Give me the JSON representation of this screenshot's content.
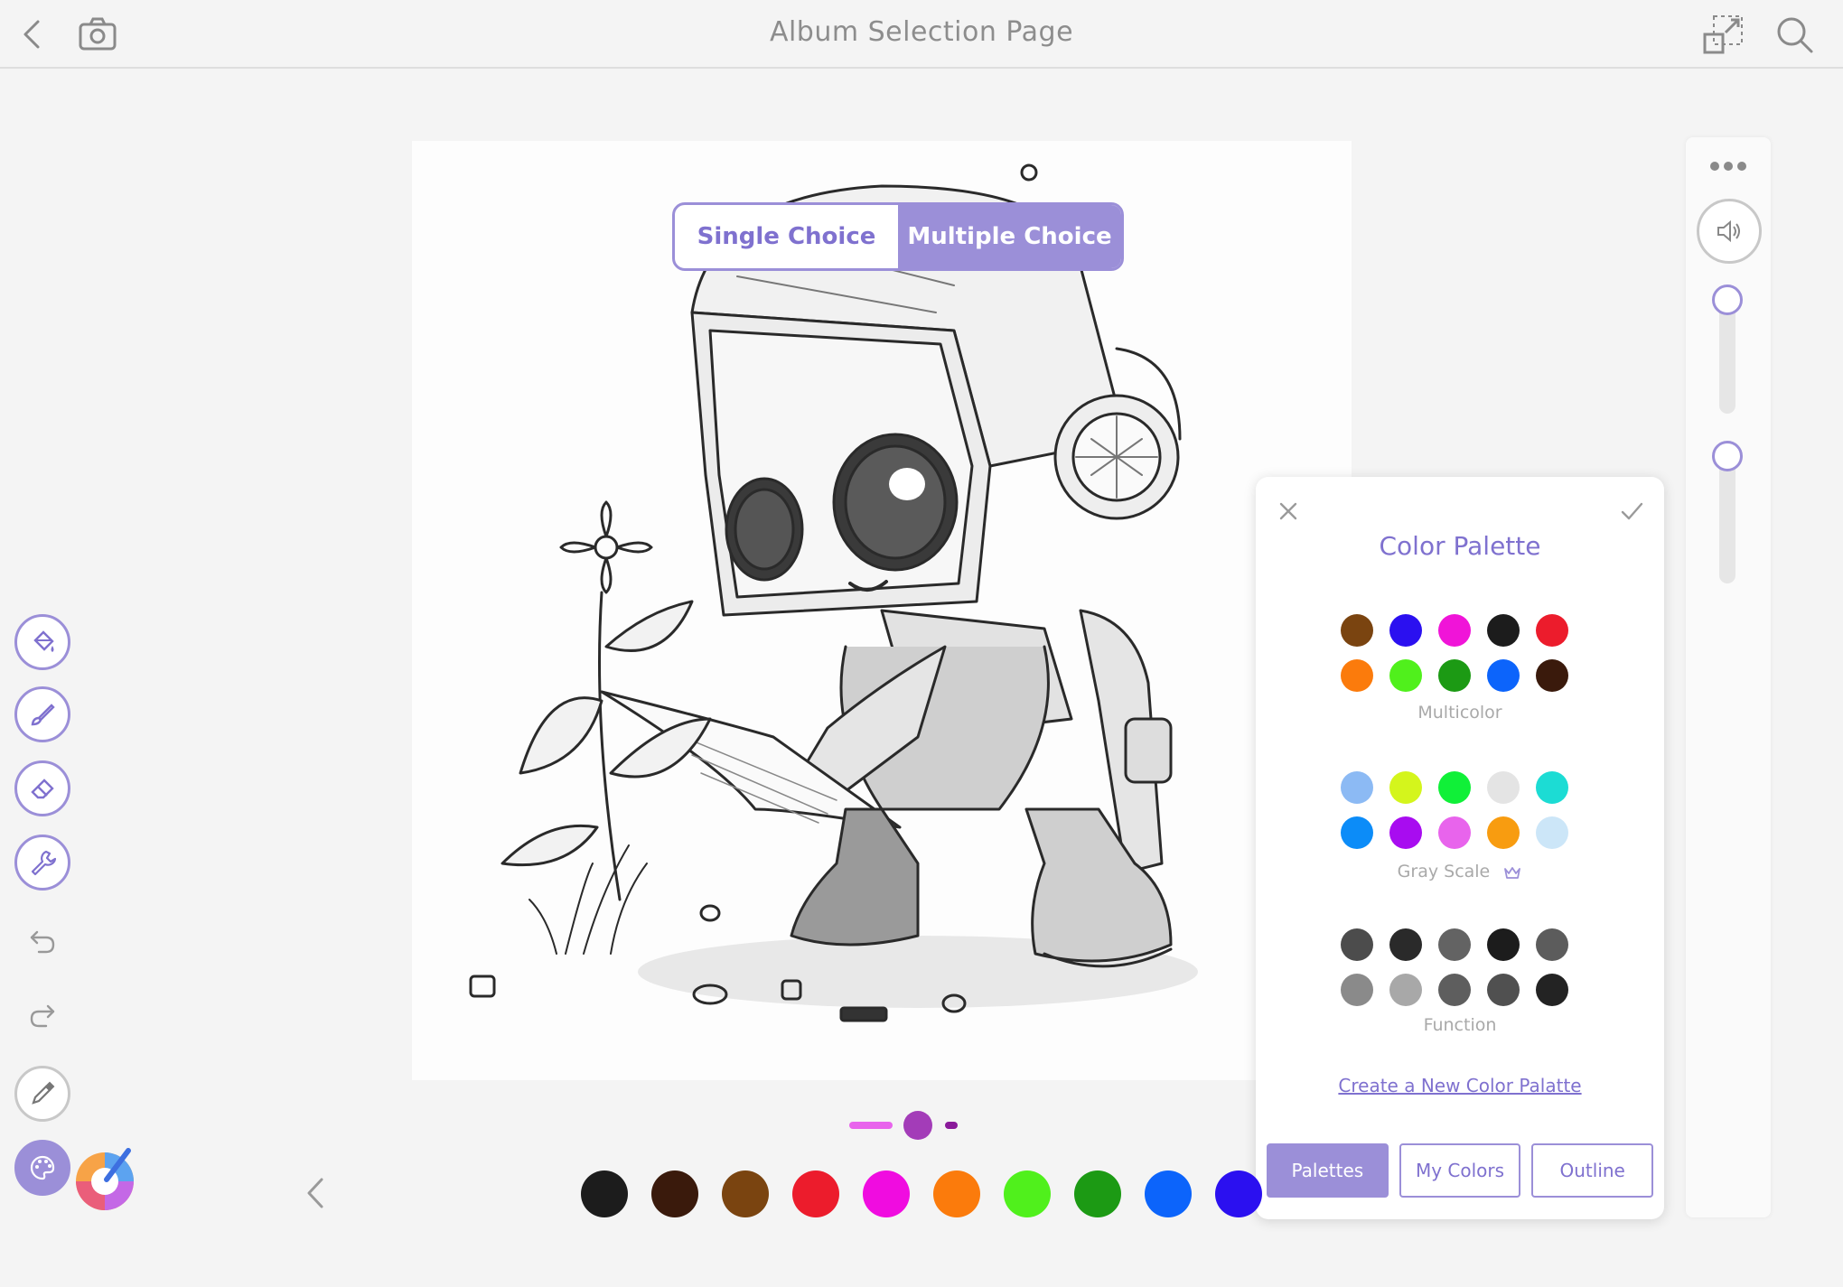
{
  "header": {
    "title": "Album Selection Page",
    "icons": [
      "back-icon",
      "camera-icon",
      "resize-icon",
      "search-icon"
    ]
  },
  "segment": {
    "options": [
      "Single Choice",
      "Multiple Choice"
    ],
    "selected": "Multiple Choice"
  },
  "palette": {
    "title": "Color Palette",
    "groups": [
      {
        "label": "Multicolor",
        "colors": [
          "#7a4410",
          "#2b10f0",
          "#f014d8",
          "#1c1c1c",
          "#ec1c2c",
          "#fb7b0c",
          "#50f01c",
          "#1c9a14",
          "#0c64fb",
          "#3a1a0c"
        ]
      },
      {
        "label": "Gray Scale",
        "colors": [
          "#8cbaf4",
          "#d4f51c",
          "#10f038",
          "#e4e4e4",
          "#1cdcd4",
          "#0c8cf8",
          "#a80cf0",
          "#e864ec",
          "#f89c10",
          "#cce6f8"
        ]
      },
      {
        "label": "Function",
        "colors": [
          "#4c4c4c",
          "#2a2a2a",
          "#636363",
          "#1c1c1c",
          "#5c5c5c",
          "#8a8a8a",
          "#a8a8a8",
          "#5e5e5e",
          "#505050",
          "#232323"
        ]
      }
    ],
    "create_link": "Create a New Color Palatte",
    "tabs": [
      "Palettes",
      "My Colors",
      "Outline"
    ],
    "active_tab": "Palettes"
  },
  "toolbar": {
    "tools": [
      "more-icon",
      "speaker-icon",
      "fill-bucket-icon",
      "brush-icon",
      "eraser-icon",
      "wrench-icon",
      "undo-icon",
      "redo-icon",
      "eyedropper-icon",
      "palette-icon"
    ]
  },
  "bottom_colors": [
    "#1c1c1c",
    "#3a1a0c",
    "#7a4410",
    "#ec1c2c",
    "#f00ce0",
    "#fb7b0c",
    "#50f01c",
    "#1c9a14",
    "#0c64fb",
    "#2b10f0"
  ],
  "pager": {
    "current": 2,
    "total": 3
  },
  "colors": {
    "accent": "#9b8fd8",
    "accent_text": "#7f71cf",
    "background": "#f4f4f4"
  }
}
